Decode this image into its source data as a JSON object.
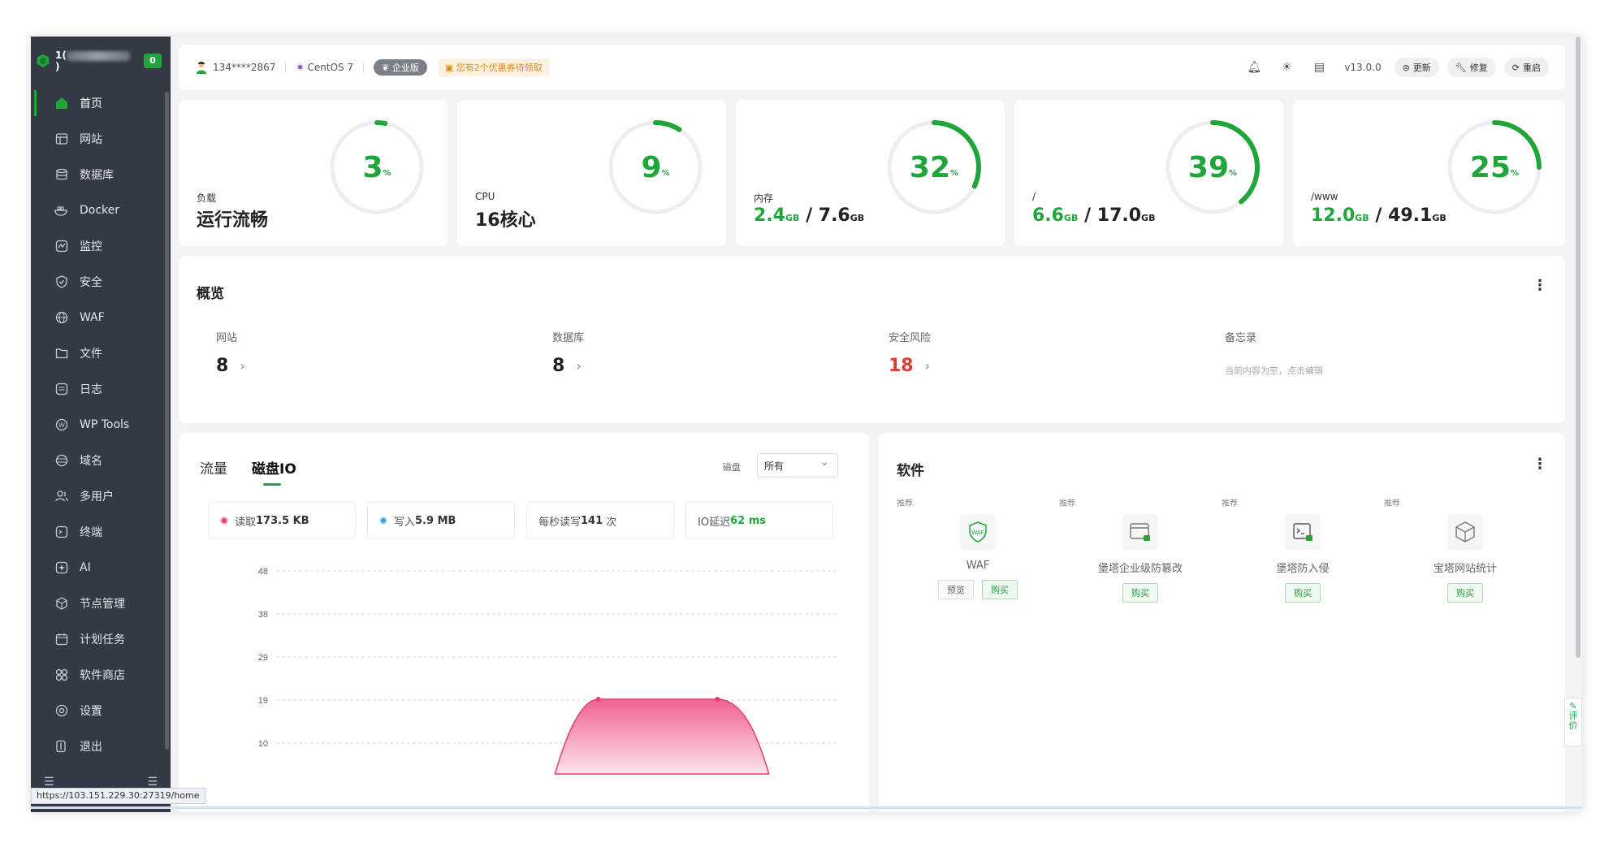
{
  "sidebar": {
    "server_prefix": "1(",
    "server_suffix": ")",
    "badge": "0",
    "items": [
      {
        "label": "首页",
        "icon": "home-icon"
      },
      {
        "label": "网站",
        "icon": "globe-window-icon"
      },
      {
        "label": "数据库",
        "icon": "database-icon"
      },
      {
        "label": "Docker",
        "icon": "docker-icon"
      },
      {
        "label": "监控",
        "icon": "monitor-icon"
      },
      {
        "label": "安全",
        "icon": "shield-icon"
      },
      {
        "label": "WAF",
        "icon": "waf-icon"
      },
      {
        "label": "文件",
        "icon": "folder-icon"
      },
      {
        "label": "日志",
        "icon": "log-icon"
      },
      {
        "label": "WP Tools",
        "icon": "wordpress-icon"
      },
      {
        "label": "域名",
        "icon": "domain-icon"
      },
      {
        "label": "多用户",
        "icon": "users-icon"
      },
      {
        "label": "终端",
        "icon": "terminal-icon"
      },
      {
        "label": "AI",
        "icon": "ai-icon"
      },
      {
        "label": "节点管理",
        "icon": "node-icon"
      },
      {
        "label": "计划任务",
        "icon": "calendar-icon"
      },
      {
        "label": "软件商店",
        "icon": "store-icon"
      },
      {
        "label": "设置",
        "icon": "settings-icon"
      },
      {
        "label": "退出",
        "icon": "logout-icon"
      }
    ],
    "status_url": "https://103.151.229.30:27319/home"
  },
  "topbar": {
    "user": "134****2867",
    "os": "CentOS 7",
    "edition": "企业版",
    "coupon": "您有2个优惠券待领取",
    "version": "v13.0.0",
    "update": "更新",
    "repair": "修复",
    "restart": "重启"
  },
  "gauges": [
    {
      "label": "负载",
      "value": "运行流畅",
      "percent": 3
    },
    {
      "label": "CPU",
      "value": "16核心",
      "percent": 9
    },
    {
      "label": "内存",
      "used": "2.4",
      "total": "7.6",
      "unit": "GB",
      "percent": 32
    },
    {
      "label": "/",
      "used": "6.6",
      "total": "17.0",
      "unit": "GB",
      "percent": 39
    },
    {
      "label": "/www",
      "used": "12.0",
      "total": "49.1",
      "unit": "GB",
      "percent": 25
    }
  ],
  "overview": {
    "title": "概览",
    "site_label": "网站",
    "site_value": "8",
    "db_label": "数据库",
    "db_value": "8",
    "risk_label": "安全风险",
    "risk_value": "18",
    "memo_label": "备忘录",
    "memo_text": "当前内容为空，点击编辑"
  },
  "traffic": {
    "tab_flow": "流量",
    "tab_disk": "磁盘IO",
    "disk_label": "磁盘",
    "disk_value": "所有",
    "read_label": "读取",
    "read_value": "173.5 KB",
    "write_label": "写入",
    "write_value": "5.9 MB",
    "rw_label": "每秒读写",
    "rw_value": "141",
    "rw_unit": "次",
    "io_label": "IO延迟",
    "io_value": "62 ms"
  },
  "chart_data": {
    "type": "area",
    "y_ticks": [
      "48",
      "38",
      "29",
      "19",
      "10"
    ],
    "ylim": [
      10,
      48
    ],
    "x": [
      0,
      1,
      2,
      3,
      4,
      5,
      6,
      7,
      8,
      9
    ],
    "series": [
      {
        "values": [
          0,
          0,
          0,
          0,
          0,
          22,
          22,
          22,
          0,
          0
        ]
      }
    ],
    "color": "#e83e6c"
  },
  "software": {
    "title": "软件",
    "rec": "推荐",
    "items": [
      {
        "name": "WAF",
        "preview": "预览",
        "buy": "购买"
      },
      {
        "name": "堡塔企业级防篡改",
        "buy": "购买"
      },
      {
        "name": "堡塔防入侵",
        "buy": "购买"
      },
      {
        "name": "宝塔网站统计",
        "buy": "购买"
      }
    ]
  },
  "feedback": "评价",
  "colors": {
    "accent": "#20a53a",
    "danger": "#e53935",
    "sidebar": "#343a45"
  }
}
